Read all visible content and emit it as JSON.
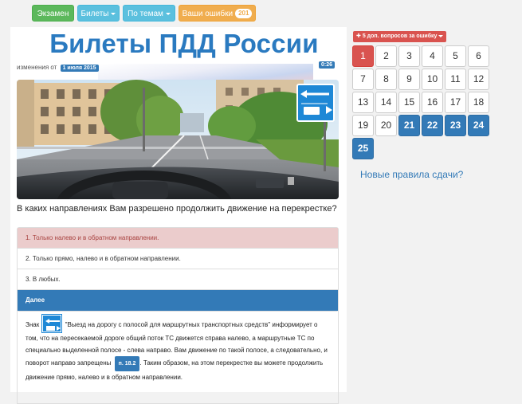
{
  "nav": {
    "exam": "Экзамен",
    "tickets": "Билеты",
    "topics": "По темам",
    "mistakes": "Ваши ошибки",
    "mistakes_count": "201"
  },
  "header": {
    "title": "Билеты ПДД России",
    "updated_prefix": "изменения от",
    "updated_date": "1 июля 2015",
    "timer": "0:26"
  },
  "question": {
    "text": "В каких направлениях Вам разрешено продолжить движение на перекрестке?",
    "answers": [
      {
        "text": "1. Только налево и в обратном направлении.",
        "state": "wrong"
      },
      {
        "text": "2. Только прямо, налево и в обратном направлении.",
        "state": "normal"
      },
      {
        "text": "3. В любых.",
        "state": "normal"
      }
    ],
    "next_label": "Далее"
  },
  "explanation": {
    "prefix": "Знак",
    "sign_name": "\"Выезд на дорогу с полосой для маршрутных транспортных средств\"",
    "body": "информирует о том, что на пересекаемой дороге общий поток ТС движется справа налево, а маршрутные ТС по специально выделенной полосе - слева направо. Вам движение по такой полосе, а следовательно, и поворот направо запрещены",
    "rule_ref": "п. 18.2",
    "conclusion": ". Таким образом, на этом перекрестке вы можете продолжить движение прямо, налево и в обратном направлении."
  },
  "sidebar": {
    "extra_button": "5 доп. вопросов за ошибку",
    "cells": [
      {
        "label": "1",
        "state": "current"
      },
      {
        "label": "2",
        "state": "normal"
      },
      {
        "label": "3",
        "state": "normal"
      },
      {
        "label": "4",
        "state": "normal"
      },
      {
        "label": "5",
        "state": "normal"
      },
      {
        "label": "6",
        "state": "normal"
      },
      {
        "label": "7",
        "state": "normal"
      },
      {
        "label": "8",
        "state": "normal"
      },
      {
        "label": "9",
        "state": "normal"
      },
      {
        "label": "10",
        "state": "normal"
      },
      {
        "label": "11",
        "state": "normal"
      },
      {
        "label": "12",
        "state": "normal"
      },
      {
        "label": "13",
        "state": "normal"
      },
      {
        "label": "14",
        "state": "normal"
      },
      {
        "label": "15",
        "state": "normal"
      },
      {
        "label": "16",
        "state": "normal"
      },
      {
        "label": "17",
        "state": "normal"
      },
      {
        "label": "18",
        "state": "normal"
      },
      {
        "label": "19",
        "state": "normal"
      },
      {
        "label": "20",
        "state": "normal"
      },
      {
        "label": "21",
        "state": "done"
      },
      {
        "label": "22",
        "state": "done"
      },
      {
        "label": "23",
        "state": "done"
      },
      {
        "label": "24",
        "state": "done"
      },
      {
        "label": "25",
        "state": "done"
      }
    ],
    "new_rules_link": "Новые правила сдачи?"
  },
  "colors": {
    "primary": "#337ab7",
    "danger": "#d9534f",
    "success": "#5cb85c",
    "info": "#5bc0de",
    "warning": "#f0ad4e"
  }
}
